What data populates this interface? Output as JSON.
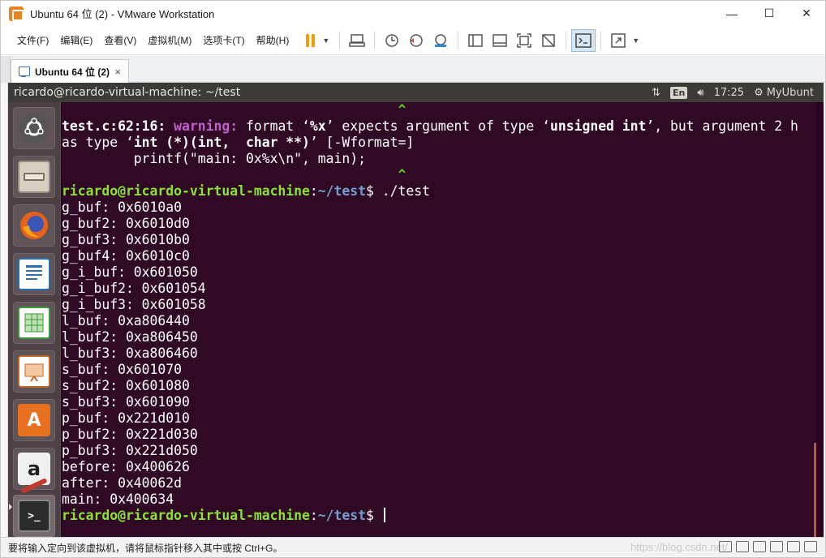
{
  "window": {
    "title": "Ubuntu 64 位 (2) - VMware Workstation",
    "min_glyph": "—",
    "max_glyph": "☐",
    "close_glyph": "✕"
  },
  "menu": [
    "文件(F)",
    "编辑(E)",
    "查看(V)",
    "虚拟机(M)",
    "选项卡(T)",
    "帮助(H)"
  ],
  "tab": {
    "label": "Ubuntu 64 位 (2)",
    "close_glyph": "×"
  },
  "guest_panel": {
    "window_title": "ricardo@ricardo-virtual-machine: ~/test",
    "keyboard_layout": "En",
    "time": "17:25",
    "session": "MyUbunt"
  },
  "launcher_items": [
    "ubuntu-dash",
    "files",
    "firefox",
    "libreoffice-writer",
    "libreoffice-calc",
    "libreoffice-impress",
    "software-center",
    "amazon",
    "system-settings",
    "terminal"
  ],
  "terminal": {
    "lines": [
      {
        "segments": [
          {
            "t": "                                          ",
            "c": ""
          },
          {
            "t": "^",
            "c": "c-caret"
          }
        ]
      },
      {
        "segments": [
          {
            "t": "test.c:62:16: ",
            "c": "c-bold"
          },
          {
            "t": "warning: ",
            "c": "c-warn"
          },
          {
            "t": "format ‘",
            "c": ""
          },
          {
            "t": "%x",
            "c": "c-bold"
          },
          {
            "t": "’ expects argument of type ‘",
            "c": ""
          },
          {
            "t": "unsigned int",
            "c": "c-bold"
          },
          {
            "t": "’, but argument 2 h",
            "c": ""
          }
        ]
      },
      {
        "segments": [
          {
            "t": "as type ‘",
            "c": ""
          },
          {
            "t": "int (*)(int,  char **)",
            "c": "c-bold"
          },
          {
            "t": "’ [-Wformat=]",
            "c": ""
          }
        ]
      },
      {
        "segments": [
          {
            "t": "         printf(\"main: 0x%x\\n\", main);",
            "c": ""
          }
        ]
      },
      {
        "segments": [
          {
            "t": "                                          ",
            "c": ""
          },
          {
            "t": "^",
            "c": "c-caret"
          }
        ]
      },
      {
        "segments": [
          {
            "t": "ricardo@ricardo-virtual-machine",
            "c": "c-prompt-user"
          },
          {
            "t": ":",
            "c": ""
          },
          {
            "t": "~/test",
            "c": "c-prompt-path"
          },
          {
            "t": "$ ./test",
            "c": ""
          }
        ]
      },
      {
        "segments": [
          {
            "t": "g_buf: 0x6010a0",
            "c": ""
          }
        ]
      },
      {
        "segments": [
          {
            "t": "g_buf2: 0x6010d0",
            "c": ""
          }
        ]
      },
      {
        "segments": [
          {
            "t": "g_buf3: 0x6010b0",
            "c": ""
          }
        ]
      },
      {
        "segments": [
          {
            "t": "g_buf4: 0x6010c0",
            "c": ""
          }
        ]
      },
      {
        "segments": [
          {
            "t": "g_i_buf: 0x601050",
            "c": ""
          }
        ]
      },
      {
        "segments": [
          {
            "t": "g_i_buf2: 0x601054",
            "c": ""
          }
        ]
      },
      {
        "segments": [
          {
            "t": "g_i_buf3: 0x601058",
            "c": ""
          }
        ]
      },
      {
        "segments": [
          {
            "t": "l_buf: 0xa806440",
            "c": ""
          }
        ]
      },
      {
        "segments": [
          {
            "t": "l_buf2: 0xa806450",
            "c": ""
          }
        ]
      },
      {
        "segments": [
          {
            "t": "l_buf3: 0xa806460",
            "c": ""
          }
        ]
      },
      {
        "segments": [
          {
            "t": "s_buf: 0x601070",
            "c": ""
          }
        ]
      },
      {
        "segments": [
          {
            "t": "s_buf2: 0x601080",
            "c": ""
          }
        ]
      },
      {
        "segments": [
          {
            "t": "s_buf3: 0x601090",
            "c": ""
          }
        ]
      },
      {
        "segments": [
          {
            "t": "p_buf: 0x221d010",
            "c": ""
          }
        ]
      },
      {
        "segments": [
          {
            "t": "p_buf2: 0x221d030",
            "c": ""
          }
        ]
      },
      {
        "segments": [
          {
            "t": "p_buf3: 0x221d050",
            "c": ""
          }
        ]
      },
      {
        "segments": [
          {
            "t": "before: 0x400626",
            "c": ""
          }
        ]
      },
      {
        "segments": [
          {
            "t": "after: 0x40062d",
            "c": ""
          }
        ]
      },
      {
        "segments": [
          {
            "t": "main: 0x400634",
            "c": ""
          }
        ]
      },
      {
        "segments": [
          {
            "t": "ricardo@ricardo-virtual-machine",
            "c": "c-prompt-user"
          },
          {
            "t": ":",
            "c": ""
          },
          {
            "t": "~/test",
            "c": "c-prompt-path"
          },
          {
            "t": "$ ",
            "c": ""
          }
        ],
        "cursor": true
      }
    ]
  },
  "status": {
    "hint": "要将输入定向到该虚拟机，请将鼠标指针移入其中或按 Ctrl+G。",
    "watermark": "https://blog.csdn.net/"
  },
  "colors": {
    "terminal_bg": "#300a24",
    "prompt_user": "#8ae234",
    "prompt_path": "#729fcf",
    "warning": "#c061cb",
    "panel_bg": "#3c3b37",
    "pause_accent": "#f39c12"
  }
}
